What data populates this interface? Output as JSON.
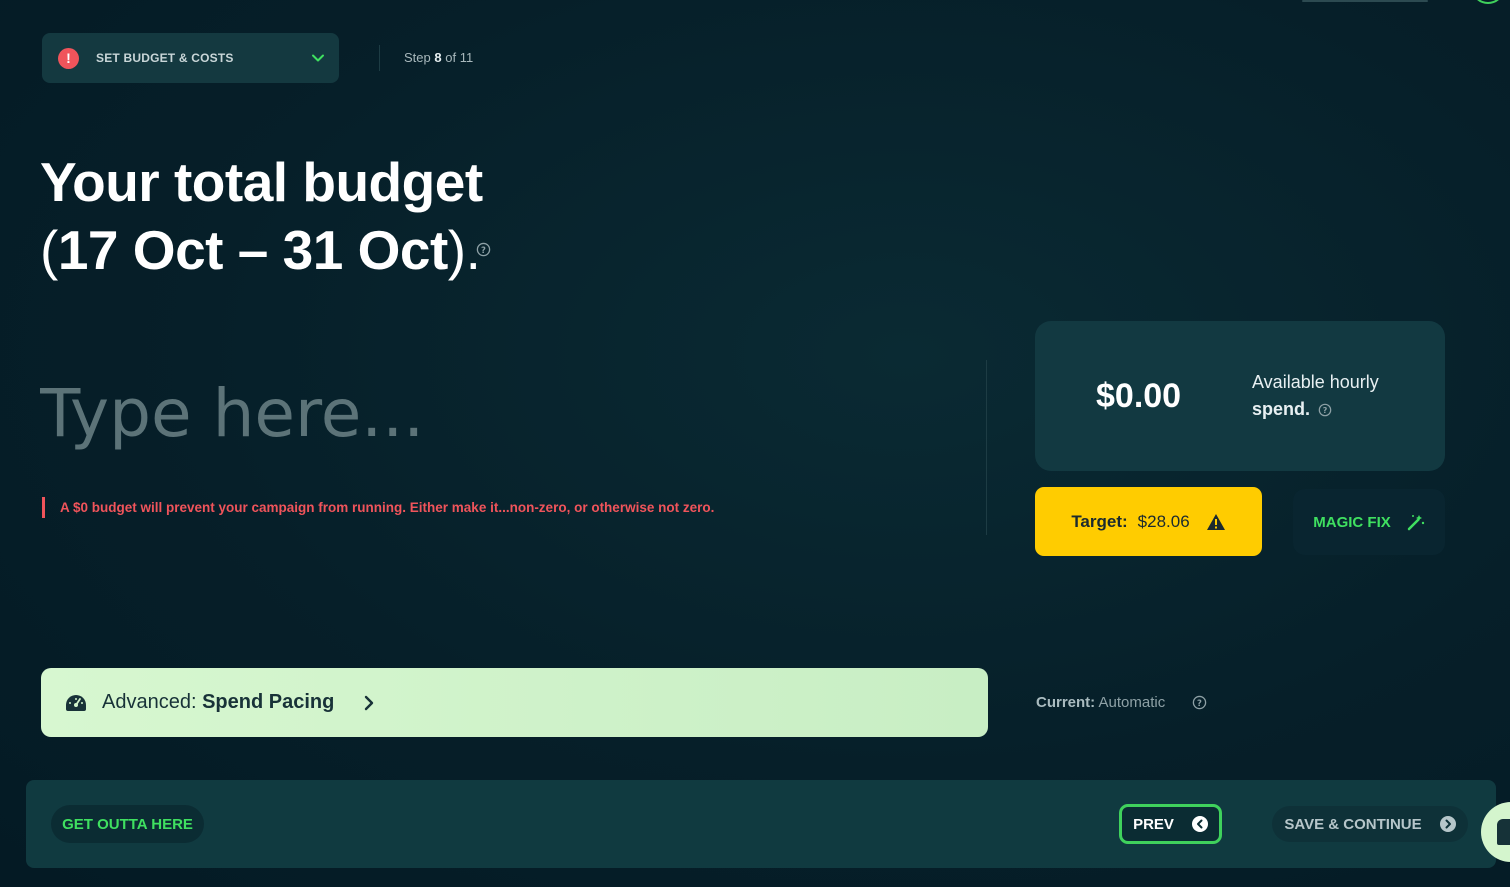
{
  "step_selector": {
    "label": "SET BUDGET & COSTS",
    "status_icon": "alert-icon"
  },
  "step_counter": {
    "prefix": "Step",
    "current": "8",
    "suffix": "of 11"
  },
  "headline": {
    "line1": "Your total budget",
    "open_paren": "(",
    "range": "17 Oct – 31 Oct",
    "close": ")."
  },
  "budget_input": {
    "value": "",
    "placeholder": "Type here..."
  },
  "error_message": "A $0 budget will prevent your campaign from running. Either make it...non-zero, or otherwise not zero.",
  "hourly": {
    "amount": "$0.00",
    "desc_line1": "Available hourly",
    "desc_line2": "spend."
  },
  "target": {
    "label": "Target:",
    "value": "$28.06"
  },
  "magic_fix": {
    "label": "MAGIC FIX"
  },
  "advanced": {
    "prefix": "Advanced:",
    "title": "Spend Pacing"
  },
  "current": {
    "label": "Current:",
    "value": "Automatic"
  },
  "footer": {
    "exit_label": "GET OUTTA HERE",
    "prev_label": "PREV",
    "save_label": "SAVE & CONTINUE"
  },
  "colors": {
    "accent_green": "#3fe060",
    "error_red": "#f0545b",
    "warning_yellow": "#ffcc00",
    "background": "#061f29"
  }
}
